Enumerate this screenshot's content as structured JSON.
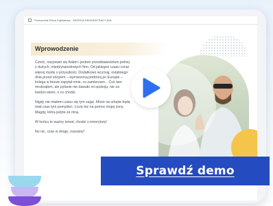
{
  "app": {
    "title": "Przewodnik Planu Kapitałowe - WERSJA DEMONSTRACYJNA"
  },
  "lesson": {
    "heading": "Wprowodzenie",
    "paragraphs": [
      "Cześć, nazywam się Adam i jestem przedstawicielem jednej z dużych, międzynarodowych firm. Od jakiegoś czasu coraz więcej myślę o przyszłości. Dodatkowo wczoraj, ostatniego dnia przed urlopem – wymarzoną podróżą po Europie – kolega w biurze zapytał mnie, co zamierzam... Coś tam mruknąłem, ale pytanie nie dawało mi spokoju, nie za bardzo wiem, o co chodzi.",
      "Nigdy nie miałem czasu się tym zająć. Może na urlopie będę miał czas tym pomyśleć. Liczę też na pomoc mojej żony, Magdy, która jedzie ze mną.",
      "W końcu to ważny temat, chodzi o emeryturę!",
      "No nic, czas w drogę, ruszamy!"
    ]
  },
  "video": {
    "play_icon": "play-icon"
  },
  "cta": {
    "label": "Sprawdź demo"
  },
  "colors": {
    "accent": "#254bc1",
    "play": "#2e6ff0",
    "yellow": "#f4c54a",
    "deco_light": "#9ad8ef",
    "deco_purple": "#7b4fd6"
  }
}
